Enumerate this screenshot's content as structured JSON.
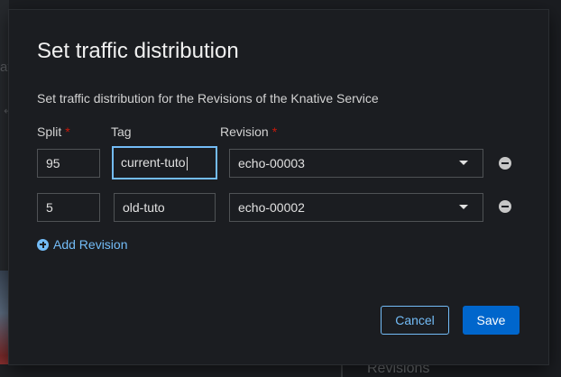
{
  "background": {
    "fragment_text": "at",
    "fragment_mark": "↵",
    "section_heading": "Revisions"
  },
  "modal": {
    "title": "Set traffic distribution",
    "description": "Set traffic distribution for the Revisions of the Knative Service",
    "columns": {
      "split": "Split",
      "tag": "Tag",
      "revision": "Revision",
      "required_marker": "*"
    },
    "rows": [
      {
        "split": "95",
        "tag": "current-tuto",
        "revision": "echo-00003"
      },
      {
        "split": "5",
        "tag": "old-tuto",
        "revision": "echo-00002"
      }
    ],
    "add_revision_label": "Add Revision",
    "cancel_label": "Cancel",
    "save_label": "Save"
  },
  "colors": {
    "link": "#73bcf7",
    "primary": "#0066cc",
    "required": "#c9190b"
  }
}
